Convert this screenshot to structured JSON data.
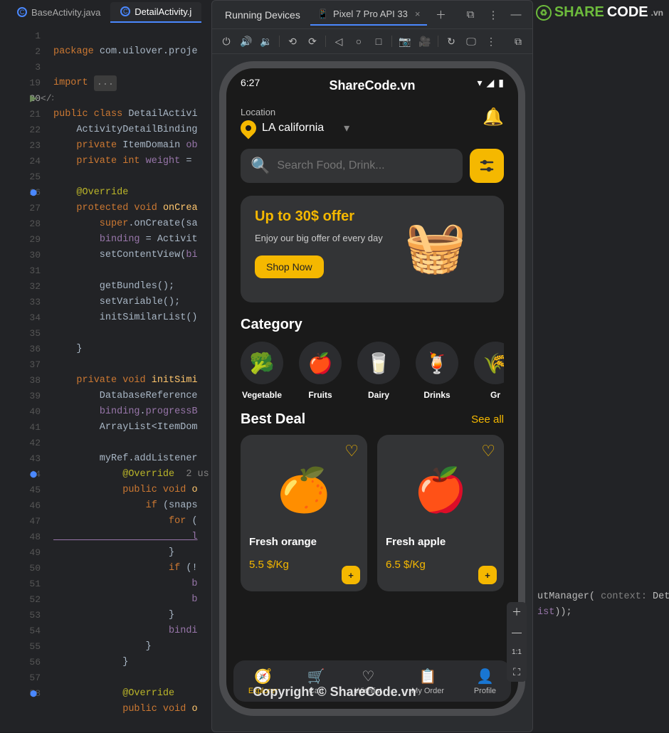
{
  "editor": {
    "tabs": [
      {
        "label": "BaseActivity.java",
        "active": false
      },
      {
        "label": "DetailActivity.j",
        "active": true
      }
    ]
  },
  "code": {
    "line_numbers": [
      "1",
      "2",
      "3",
      "19",
      "20",
      "21",
      "22",
      "23",
      "24",
      "25",
      "26",
      "27",
      "28",
      "29",
      "30",
      "31",
      "32",
      "33",
      "34",
      "35",
      "36",
      "37",
      "38",
      "39",
      "40",
      "41",
      "42",
      "43",
      "44",
      "45",
      "46",
      "47",
      "48",
      "49",
      "50",
      "51",
      "52",
      "53",
      "54",
      "55",
      "56",
      "57",
      "58"
    ],
    "current_line": "20",
    "pkg_kw": "package",
    "pkg_val": " com.uilover.proje",
    "import_kw": "import",
    "import_box": "...",
    "l20": {
      "a": "public class ",
      "b": "DetailActivi"
    },
    "l21": "    ActivityDetailBinding",
    "l22": {
      "a": "    private ",
      "b": "ItemDomain ",
      "c": "ob"
    },
    "l23": {
      "a": "    private int ",
      "b": "weight",
      "c": " = "
    },
    "l25": "    @Override",
    "l26": {
      "a": "    protected void ",
      "b": "onCrea"
    },
    "l27": {
      "a": "        super",
      "b": ".onCreate(sa"
    },
    "l28": {
      "a": "        ",
      "b": "binding",
      "c": " = Activit"
    },
    "l29": {
      "a": "        setContentView(",
      "b": "bi"
    },
    "l31": "        getBundles();",
    "l32": "        setVariable();",
    "l33": "        initSimilarList()",
    "l35": "    }",
    "l37": {
      "a": "    private void ",
      "b": "initSimi"
    },
    "l38": "        DatabaseReference",
    "l39": {
      "a": "        ",
      "b": "binding",
      "c": ".",
      "d": "progressB"
    },
    "l40": "        ArrayList<ItemDom",
    "l42": "        myRef.addListener",
    "l43_ann": "            @Override",
    "l43_usage": "  2 us",
    "l44": {
      "a": "            public void ",
      "b": "o"
    },
    "l45": {
      "a": "                if ",
      "b": "(snaps"
    },
    "l46": {
      "a": "                    for ",
      "b": "("
    },
    "l47": "                        l",
    "l48": "                    }",
    "l49": {
      "a": "                    if ",
      "b": "(!"
    },
    "l50": "                        b",
    "l50_right": {
      "a": "utManager( ",
      "b": "context:",
      "c": " Detail"
    },
    "l51": "                        b",
    "l51_right": {
      "a": "ist",
      "b": "));"
    },
    "l52": "                    }",
    "l53": {
      "a": "                    ",
      "b": "bindi"
    },
    "l54": "                }",
    "l55": "            }",
    "l57": "            @Override",
    "l58": {
      "a": "            public void ",
      "b": "o"
    }
  },
  "running_devices": {
    "header": "Running Devices",
    "tab_label": "Pixel 7 Pro API 33"
  },
  "phone": {
    "time": "6:27",
    "title": "ShareCode.vn",
    "location_label": "Location",
    "location_value": "LA california",
    "search_placeholder": "Search Food, Drink...",
    "banner_title": "Up to 30$ offer",
    "banner_sub": "Enjoy our big offer of every day",
    "shop_now": "Shop Now",
    "category_h": "Category",
    "categories": [
      {
        "label": "Vegetable",
        "emoji": "🥦"
      },
      {
        "label": "Fruits",
        "emoji": "🍎"
      },
      {
        "label": "Dairy",
        "emoji": "🥛"
      },
      {
        "label": "Drinks",
        "emoji": "🍹"
      },
      {
        "label": "Gr",
        "emoji": "🌾"
      }
    ],
    "best_deal_h": "Best Deal",
    "see_all": "See all",
    "deals": [
      {
        "name": "Fresh orange",
        "price": "5.5 $/Kg",
        "emoji": "🍊"
      },
      {
        "name": "Fresh apple",
        "price": "6.5 $/Kg",
        "emoji": "🍎"
      }
    ],
    "nav": [
      {
        "label": "Explorer",
        "icon": "🧭",
        "active": true
      },
      {
        "label": "Cart",
        "icon": "🛒",
        "active": false
      },
      {
        "label": "Wishlist",
        "icon": "♡",
        "active": false
      },
      {
        "label": "My Order",
        "icon": "📋",
        "active": false
      },
      {
        "label": "Profile",
        "icon": "👤",
        "active": false
      }
    ]
  },
  "watermark": {
    "share": "SHARE",
    "code": "CODE",
    "vn": ".vn",
    "copyright": "Copyright © ShareCode.vn"
  }
}
